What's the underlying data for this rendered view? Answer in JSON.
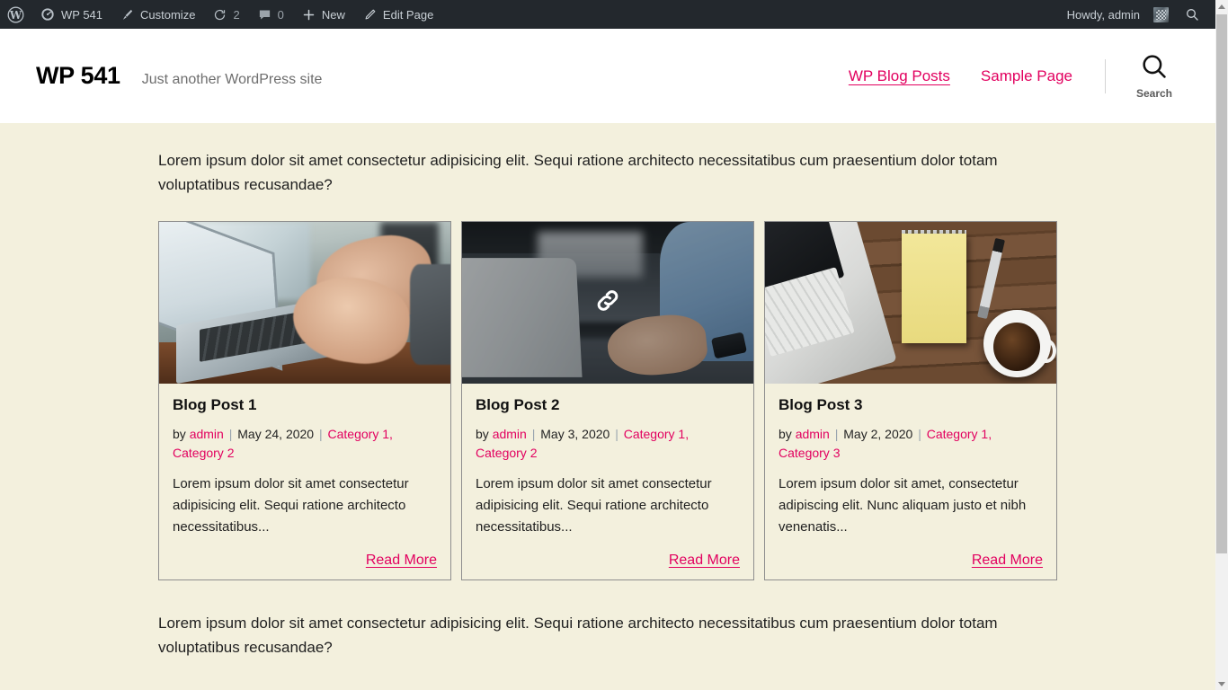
{
  "admin_bar": {
    "items": [
      {
        "icon": "wordpress-logo-icon",
        "label": ""
      },
      {
        "icon": "dashboard-speedometer-icon",
        "label": "WP 541"
      },
      {
        "icon": "paintbrush-icon",
        "label": "Customize"
      },
      {
        "icon": "refresh-icon",
        "label": "2"
      },
      {
        "icon": "comment-bubble-icon",
        "label": "0"
      },
      {
        "icon": "plus-icon",
        "label": "New"
      },
      {
        "icon": "pencil-icon",
        "label": "Edit Page"
      }
    ],
    "wp_logo_label": "",
    "site_name": "WP 541",
    "customize_label": "Customize",
    "updates_count": "2",
    "comments_count": "0",
    "new_label": "New",
    "edit_page_label": "Edit Page",
    "howdy": "Howdy, admin",
    "search_icon": "search-icon",
    "bg_color": "#23282d",
    "text_color": "#c8cfd5"
  },
  "site_header": {
    "title": "WP 541",
    "description": "Just another WordPress site",
    "nav": [
      {
        "label": "WP Blog Posts",
        "current": true
      },
      {
        "label": "Sample Page",
        "current": false
      }
    ],
    "search": {
      "icon": "search-icon",
      "label": "Search"
    },
    "link_color": "#e2005f",
    "bg_color": "#ffffff"
  },
  "content": {
    "bg_color": "#f3f0dd",
    "intro_paragraph": "Lorem ipsum dolor sit amet consectetur adipisicing elit. Sequi ratione architecto necessitatibus cum praesentium dolor totam voluptatibus recusandae?",
    "outro_paragraph": "Lorem ipsum dolor sit amet consectetur adipisicing elit. Sequi ratione architecto necessitatibus cum praesentium dolor totam voluptatibus recusandae?",
    "posts": [
      {
        "title": "Blog Post 1",
        "by_label": "by",
        "author": "admin",
        "date": "May 24, 2020",
        "categories": [
          "Category 1",
          "Category 2"
        ],
        "categories_text": "Category 1, Category 2",
        "excerpt": "Lorem ipsum dolor sit amet consectetur adipisicing elit. Sequi ratione architecto necessitatibus...",
        "read_more": "Read More",
        "image": "hands-typing-on-laptop-photo",
        "hovered": false
      },
      {
        "title": "Blog Post 2",
        "by_label": "by",
        "author": "admin",
        "date": "May 3, 2020",
        "categories": [
          "Category 1",
          "Category 2"
        ],
        "categories_text": "Category 1, Category 2",
        "excerpt": "Lorem ipsum dolor sit amet consectetur adipisicing elit. Sequi ratione architecto necessitatibus...",
        "read_more": "Read More",
        "image": "person-in-blue-shirt-at-laptop-photo",
        "hovered": true
      },
      {
        "title": "Blog Post 3",
        "by_label": "by",
        "author": "admin",
        "date": "May 2, 2020",
        "categories": [
          "Category 1",
          "Category 3"
        ],
        "categories_text": "Category 1, Category 3",
        "excerpt": "Lorem ipsum dolor sit amet, consectetur adipiscing elit. Nunc aliquam justo et nibh venenatis...",
        "read_more": "Read More",
        "image": "desk-flatlay-notepad-coffee-photo",
        "hovered": false
      }
    ],
    "separator": "|",
    "cursor_icon": "link-chain-icon"
  },
  "scrollbar": {
    "up_icon": "scroll-up-arrow-icon",
    "down_icon": "scroll-down-arrow-icon",
    "thumb": "scrollbar-thumb"
  }
}
